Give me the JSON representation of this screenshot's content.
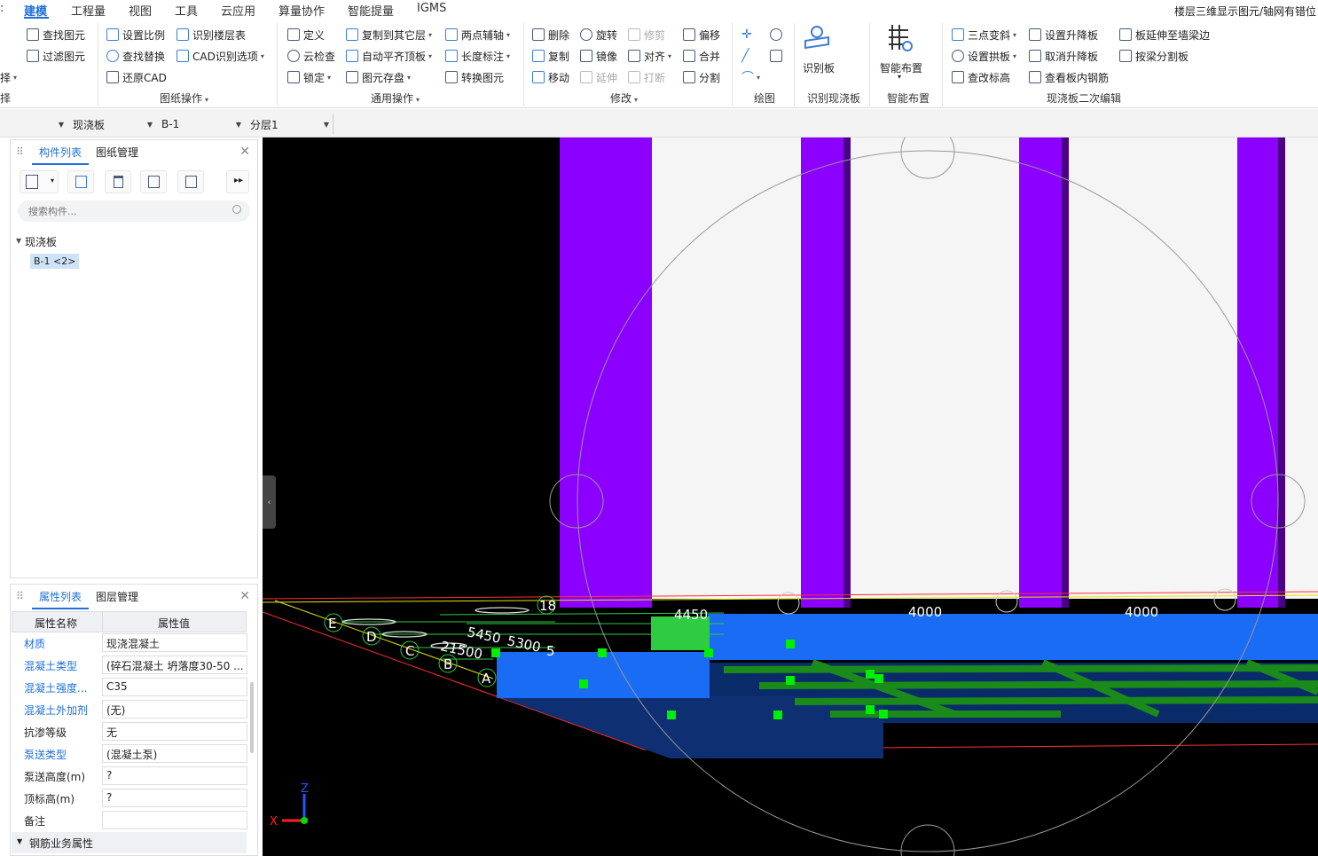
{
  "menu": {
    "items": [
      "建模",
      "工程量",
      "视图",
      "工具",
      "云应用",
      "算量协作",
      "智能提量",
      "IGMS"
    ],
    "active": "建模",
    "right_note": "楼层三维显示图元/轴网有错位"
  },
  "ribbon": {
    "partial_left": [
      "择"
    ],
    "selection": {
      "find": "查找图元",
      "filter": "过滤图元"
    },
    "drawing_ops": {
      "set_scale": "设置比例",
      "identify_floor_table": "识别楼层表",
      "find_replace": "查找替换",
      "cad_options": "CAD识别选项",
      "restore_cad": "还原CAD",
      "label": "图纸操作"
    },
    "common_ops": {
      "define": "定义",
      "copy_to_layer": "复制到其它层",
      "two_point_aux": "两点辅轴",
      "cloud_check": "云检查",
      "auto_flush": "自动平齐顶板",
      "length_dim": "长度标注",
      "lock": "锁定",
      "save_elements": "图元存盘",
      "convert_elements": "转换图元",
      "label": "通用操作"
    },
    "modify": {
      "delete": "删除",
      "rotate": "旋转",
      "trim": "修剪",
      "offset": "偏移",
      "copy": "复制",
      "mirror": "镜像",
      "align": "对齐",
      "merge": "合并",
      "move": "移动",
      "extend": "延伸",
      "break": "打断",
      "split": "分割",
      "label": "修改"
    },
    "draw": {
      "label": "绘图"
    },
    "identify_slab": {
      "button": "识别板",
      "label": "识别现浇板"
    },
    "smart_layout": {
      "button": "智能布置",
      "label": "智能布置"
    },
    "slab_edit": {
      "three_point_slope": "三点变斜",
      "set_raise": "设置升降板",
      "extend_slab": "板延伸至墙梁边",
      "set_arch": "设置拱板",
      "cancel_raise": "取消升降板",
      "split_by_beam": "按梁分割板",
      "check_elevation": "查改标高",
      "view_rebar": "查看板内钢筋",
      "label": "现浇板二次编辑"
    }
  },
  "toolbar": {
    "type_select": "现浇板",
    "name_select": "B-1",
    "layer_select": "分层1"
  },
  "component_panel": {
    "tabs": [
      "构件列表",
      "图纸管理"
    ],
    "search_placeholder": "搜索构件...",
    "tree_group": "现浇板",
    "tree_item": "B-1 <2>"
  },
  "property_panel": {
    "tabs": [
      "属性列表",
      "图层管理"
    ],
    "header": [
      "属性名称",
      "属性值"
    ],
    "rows": [
      {
        "name": "材质",
        "value": "现浇混凝土",
        "link": true
      },
      {
        "name": "混凝土类型",
        "value": "(碎石混凝土 坍落度30-50 ...",
        "link": true
      },
      {
        "name": "混凝土强度...",
        "value": "C35",
        "link": true
      },
      {
        "name": "混凝土外加剂",
        "value": "(无)",
        "link": true
      },
      {
        "name": "抗渗等级",
        "value": "无",
        "link": false
      },
      {
        "name": "泵送类型",
        "value": "(混凝土泵)",
        "link": true
      },
      {
        "name": "泵送高度(m)",
        "value": "?",
        "link": false
      },
      {
        "name": "顶标高(m)",
        "value": "?",
        "link": false
      },
      {
        "name": "备注",
        "value": "",
        "link": false
      }
    ],
    "section": "钢筋业务属性"
  },
  "viewport": {
    "axis_labels": [
      "E",
      "D",
      "C",
      "B",
      "A"
    ],
    "dims": [
      "18",
      "5450",
      "5300",
      "21500",
      "5",
      "4450",
      "4000",
      "4000"
    ],
    "axes": {
      "z": "Z",
      "x": "X"
    },
    "colors": {
      "beam": "#8b00ff",
      "slab": "#1b6cf5",
      "slab_dark": "#0f2f73",
      "rebar": "#22aa22",
      "grip": "#00ee00"
    }
  }
}
